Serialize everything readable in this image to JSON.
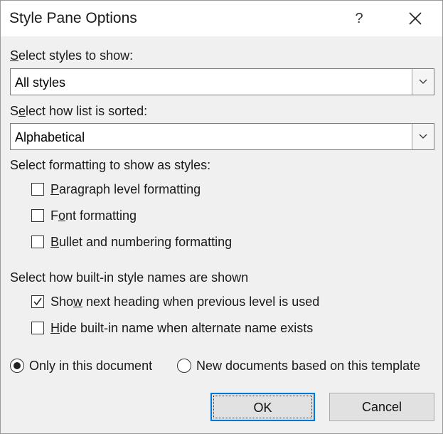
{
  "dialog": {
    "title": "Style Pane Options",
    "help_glyph": "?"
  },
  "styles_to_show": {
    "label": "Select styles to show:",
    "value": "All styles"
  },
  "list_sorted": {
    "label": "Select how list is sorted:",
    "value": "Alphabetical"
  },
  "formatting": {
    "label": "Select formatting to show as styles:",
    "items": [
      {
        "label": "Paragraph level formatting",
        "checked": false
      },
      {
        "label": "Font formatting",
        "checked": false
      },
      {
        "label": "Bullet and numbering formatting",
        "checked": false
      }
    ]
  },
  "builtin_names": {
    "label": "Select how built-in style names are shown",
    "items": [
      {
        "label": "Show next heading when previous level is used",
        "checked": true
      },
      {
        "label": "Hide built-in name when alternate name exists",
        "checked": false
      }
    ]
  },
  "scope": {
    "options": [
      {
        "label": "Only in this document",
        "selected": true
      },
      {
        "label": "New documents based on this template",
        "selected": false
      }
    ]
  },
  "buttons": {
    "ok": "OK",
    "cancel": "Cancel"
  }
}
